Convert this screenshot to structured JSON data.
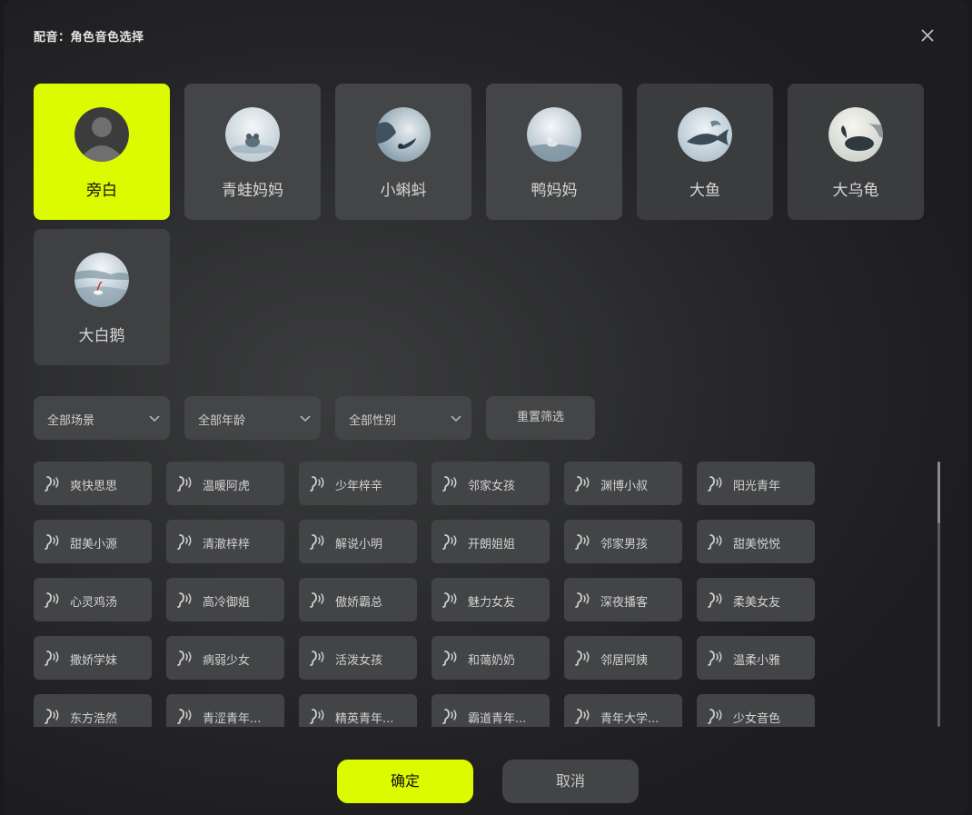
{
  "dialog": {
    "title": "配音：角色音色选择",
    "close_icon": "close-icon"
  },
  "roles": [
    {
      "name": "旁白",
      "selected": true,
      "avatar": "person-placeholder"
    },
    {
      "name": "青蛙妈妈",
      "selected": false,
      "avatar": "frog-ink-painting"
    },
    {
      "name": "小蝌蚪",
      "selected": false,
      "avatar": "tadpole-ink-painting"
    },
    {
      "name": "鸭妈妈",
      "selected": false,
      "avatar": "duck-ink-painting"
    },
    {
      "name": "大鱼",
      "selected": false,
      "avatar": "fish-ink-painting"
    },
    {
      "name": "大乌龟",
      "selected": false,
      "avatar": "turtle-ink-painting"
    },
    {
      "name": "大白鹅",
      "selected": false,
      "avatar": "goose-ink-painting"
    }
  ],
  "filters": {
    "scene": "全部场景",
    "age": "全部年龄",
    "gender": "全部性别",
    "reset": "重置筛选"
  },
  "voices": [
    [
      "爽快思思",
      "温暖阿虎",
      "少年梓辛",
      "邻家女孩",
      "渊博小叔",
      "阳光青年"
    ],
    [
      "甜美小源",
      "清澈梓梓",
      "解说小明",
      "开朗姐姐",
      "邻家男孩",
      "甜美悦悦"
    ],
    [
      "心灵鸡汤",
      "高冷御姐",
      "傲娇霸总",
      "魅力女友",
      "深夜播客",
      "柔美女友"
    ],
    [
      "撒娇学妹",
      "病弱少女",
      "活泼女孩",
      "和蔼奶奶",
      "邻居阿姨",
      "温柔小雅"
    ],
    [
      "东方浩然",
      "青涩青年...",
      "精英青年...",
      "霸道青年...",
      "青年大学...",
      "少女音色"
    ]
  ],
  "footer": {
    "confirm": "确定",
    "cancel": "取消"
  },
  "colors": {
    "accent": "#dcfb00",
    "card": "#444546",
    "background": "#2b2c2d"
  }
}
